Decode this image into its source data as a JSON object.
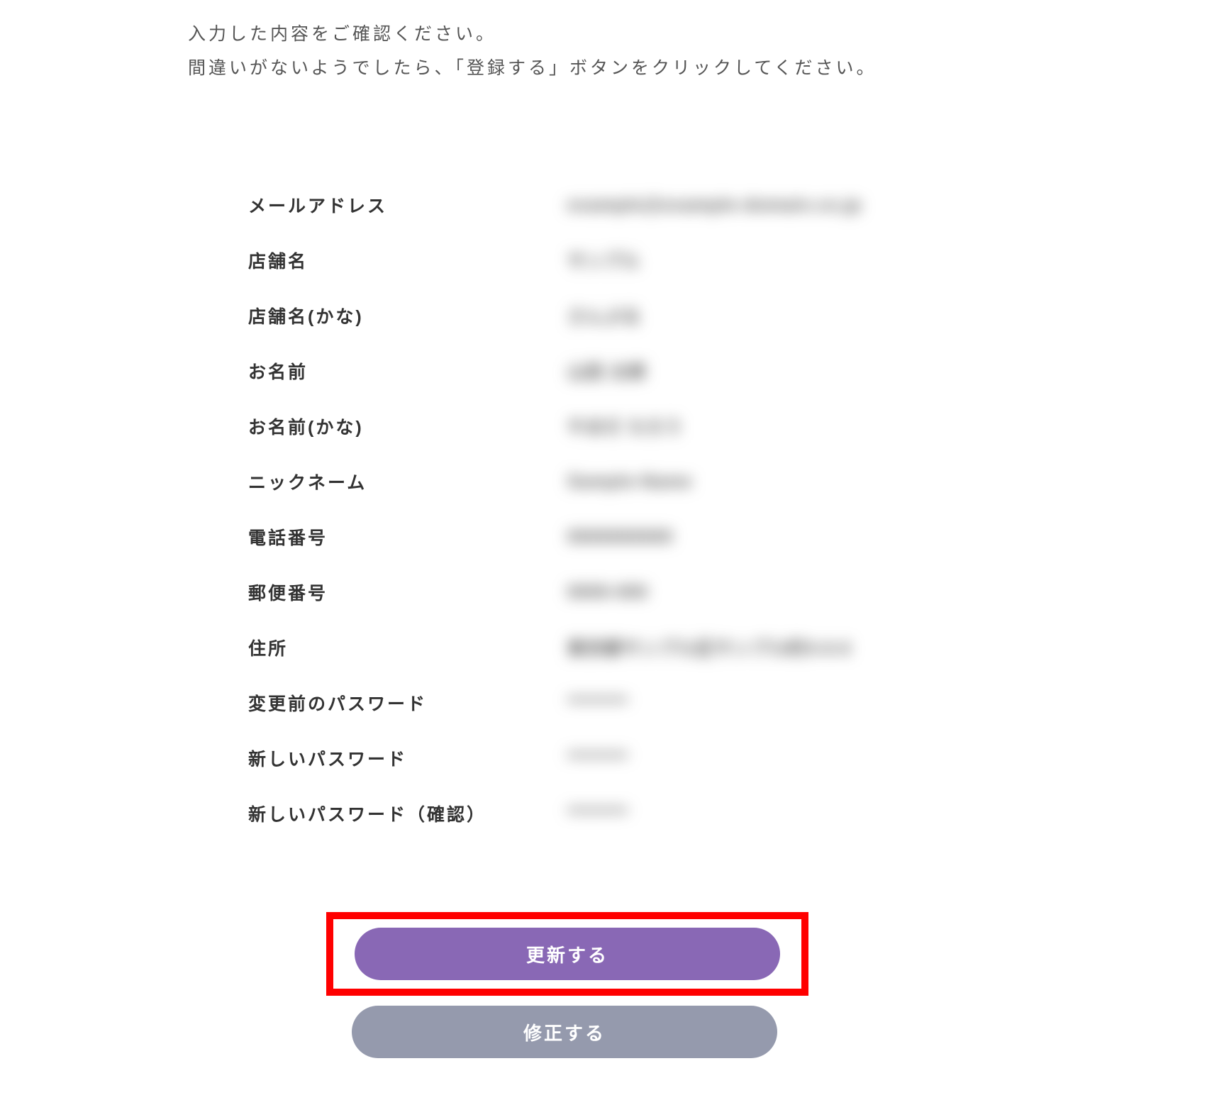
{
  "intro": {
    "line1": "入力した内容をご確認ください。",
    "line2": "間違いがないようでしたら、「登録する」ボタンをクリックしてください。"
  },
  "fields": {
    "email": {
      "label": "メールアドレス",
      "value": "example@example-domain.co.jp"
    },
    "shop": {
      "label": "店舗名",
      "value": "サンプル"
    },
    "shop_kana": {
      "label": "店舗名(かな)",
      "value": "さんぷる"
    },
    "name": {
      "label": "お名前",
      "value": "山田 太郎"
    },
    "name_kana": {
      "label": "お名前(かな)",
      "value": "やまだ たろう"
    },
    "nickname": {
      "label": "ニックネーム",
      "value": "Sample-Name"
    },
    "tel": {
      "label": "電話番号",
      "value": "0000000000"
    },
    "zip": {
      "label": "郵便番号",
      "value": "0000-000"
    },
    "address": {
      "label": "住所",
      "value": "東京都サンプル区サンプル町0-0-0"
    },
    "pw_old": {
      "label": "変更前のパスワード",
      "value": "********"
    },
    "pw_new": {
      "label": "新しいパスワード",
      "value": "********"
    },
    "pw_new2": {
      "label": "新しいパスワード（確認）",
      "value": "********"
    }
  },
  "buttons": {
    "update": "更新する",
    "modify": "修正する"
  }
}
